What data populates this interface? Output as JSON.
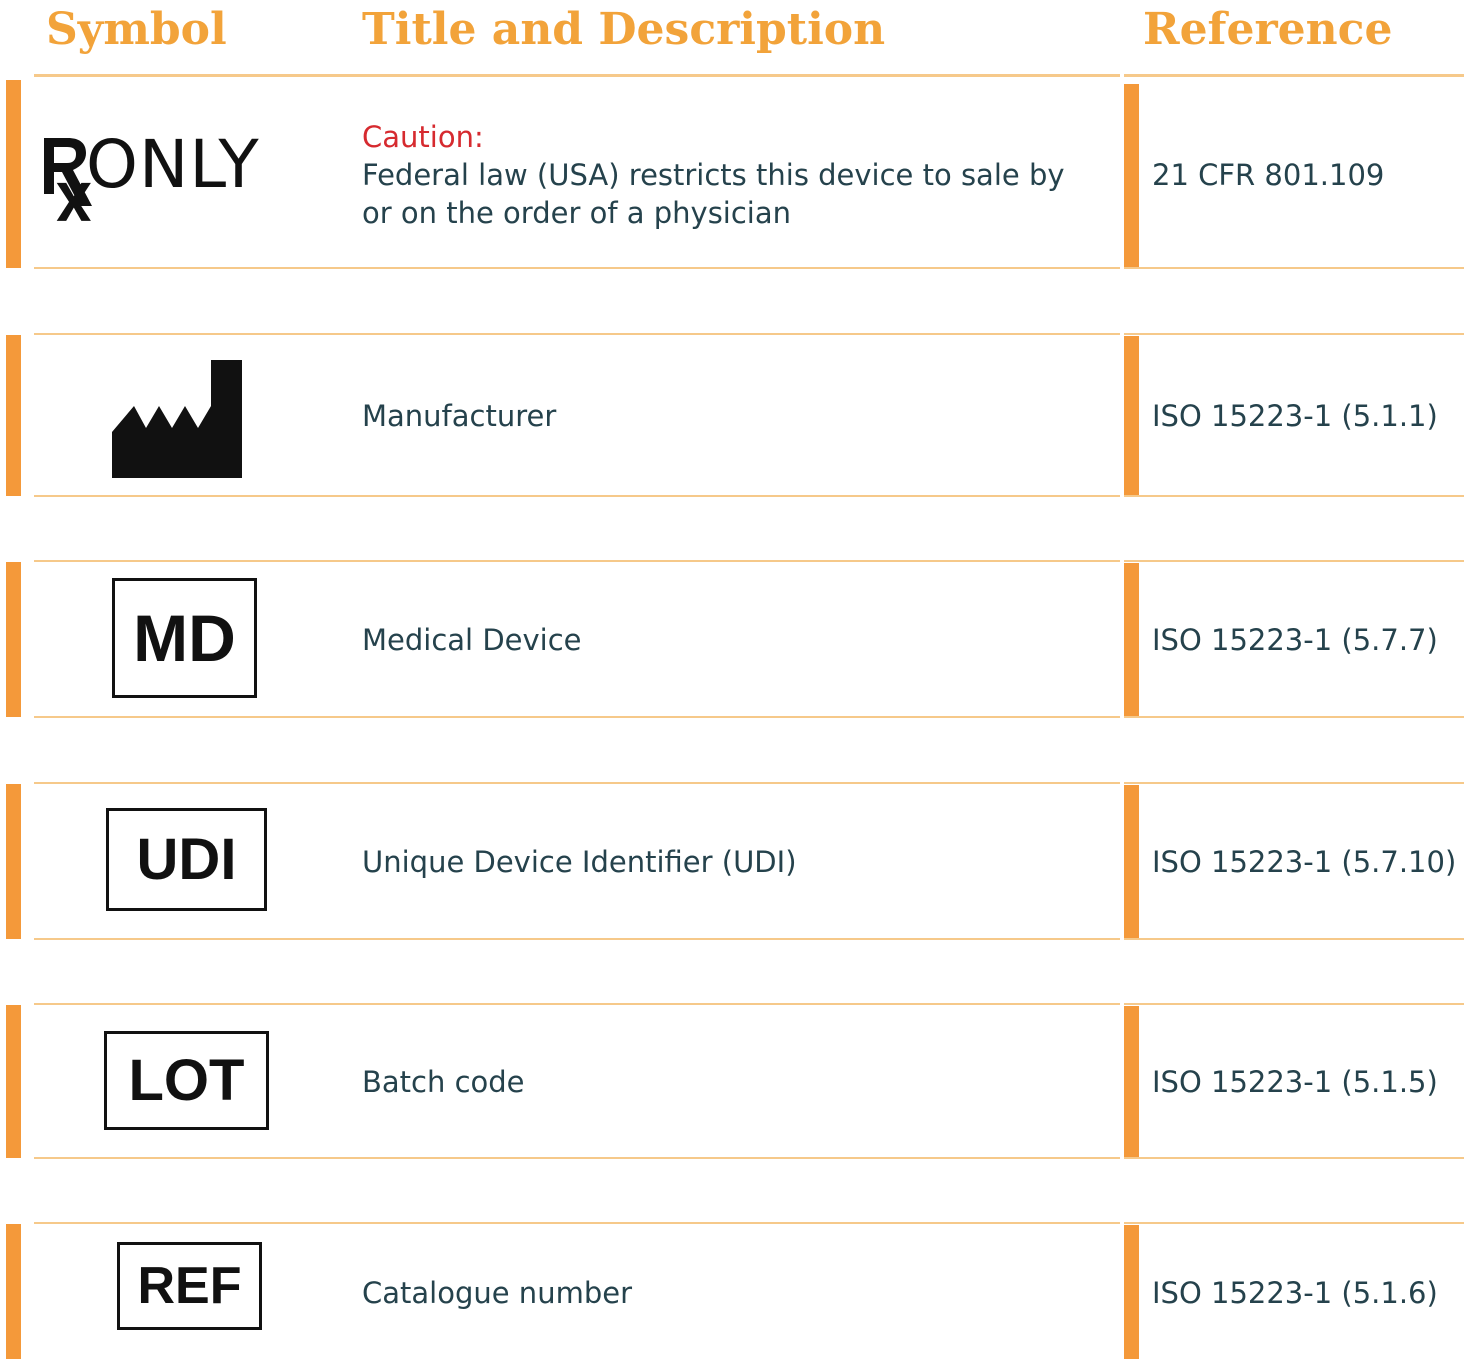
{
  "header": {
    "symbol_label": "Symbol",
    "title_label": "Title and Description",
    "reference_label": "Reference"
  },
  "colors": {
    "accent": "#f4993a",
    "header_text": "#f2a33a",
    "rule": "#f6c98a",
    "body_text": "#25424c",
    "caution_text": "#d62a2f"
  },
  "rows": [
    {
      "symbol": "rx-only-icon",
      "symbol_text": "ONLY",
      "caution": "Caution:",
      "description_line1": "Federal law (USA) restricts this device to sale by",
      "description_line2": "or on the order of a physician",
      "reference": "21 CFR 801.109"
    },
    {
      "symbol": "factory-icon",
      "description": "Manufacturer",
      "reference": "ISO 15223-1 (5.1.1)"
    },
    {
      "symbol": "md-box-icon",
      "symbol_text": "MD",
      "description": "Medical Device",
      "reference": "ISO 15223-1 (5.7.7)"
    },
    {
      "symbol": "udi-box-icon",
      "symbol_text": "UDI",
      "description": "Unique Device Identifier (UDI)",
      "reference": "ISO 15223-1 (5.7.10)"
    },
    {
      "symbol": "lot-box-icon",
      "symbol_text": "LOT",
      "description": "Batch code",
      "reference": "ISO 15223-1 (5.1.5)"
    },
    {
      "symbol": "ref-box-icon",
      "symbol_text": "REF",
      "description": "Catalogue number",
      "reference": "ISO 15223-1 (5.1.6)"
    }
  ]
}
